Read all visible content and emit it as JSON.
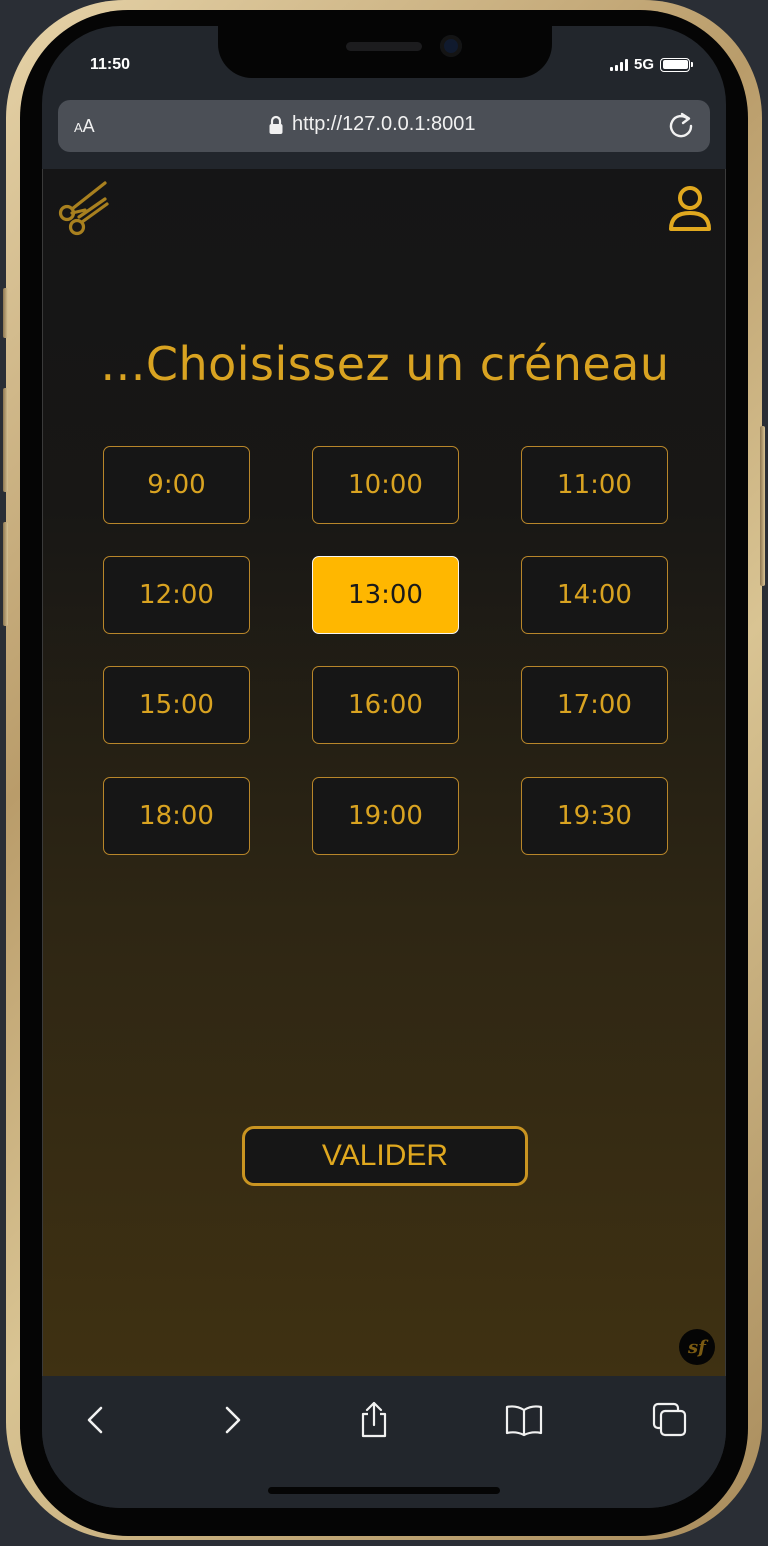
{
  "status_bar": {
    "time": "11:50",
    "network": "5G"
  },
  "browser": {
    "text_size_button": {
      "small": "A",
      "large": "A"
    },
    "url": "http://127.0.0.1:8001"
  },
  "page": {
    "title": "...Choisissez un créneau",
    "slots": [
      {
        "label": "9:00",
        "selected": false
      },
      {
        "label": "10:00",
        "selected": false
      },
      {
        "label": "11:00",
        "selected": false
      },
      {
        "label": "12:00",
        "selected": false
      },
      {
        "label": "13:00",
        "selected": true
      },
      {
        "label": "14:00",
        "selected": false
      },
      {
        "label": "15:00",
        "selected": false
      },
      {
        "label": "16:00",
        "selected": false
      },
      {
        "label": "17:00",
        "selected": false
      },
      {
        "label": "18:00",
        "selected": false
      },
      {
        "label": "19:00",
        "selected": false
      },
      {
        "label": "19:30",
        "selected": false
      }
    ],
    "validate_label": "VALIDER",
    "debug_badge": "sf"
  },
  "colors": {
    "accent": "#d9a321",
    "selected_slot": "#ffb700",
    "background_top": "#151516",
    "background_bottom": "#3f3112"
  },
  "icons": {
    "logo": "scissors-icon",
    "account": "user-icon",
    "lock": "lock-icon",
    "reload": "reload-icon",
    "toolbar": [
      "back-icon",
      "forward-icon",
      "share-icon",
      "bookmarks-icon",
      "tabs-icon"
    ]
  }
}
